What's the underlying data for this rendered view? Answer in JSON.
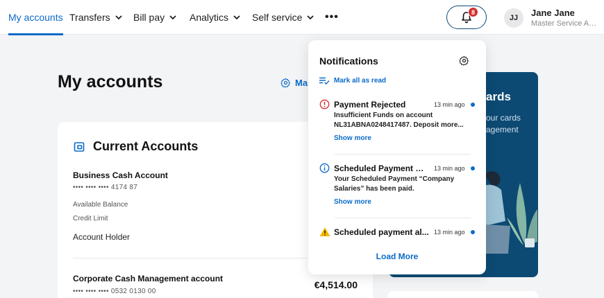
{
  "nav": {
    "items": [
      {
        "label": "My accounts"
      },
      {
        "label": "Transfers"
      },
      {
        "label": "Bill pay"
      },
      {
        "label": "Analytics"
      },
      {
        "label": "Self service"
      }
    ],
    "more": "•••",
    "notification_count": "8"
  },
  "user": {
    "initials": "JJ",
    "name": "Jane Jane",
    "role": "Master Service Agr..."
  },
  "page": {
    "title": "My accounts",
    "manage_label": "Ma"
  },
  "accounts": {
    "title": "Current Accounts",
    "list": [
      {
        "name": "Business Cash Account",
        "number": "•••• •••• •••• 4174 87",
        "available_label": "Available Balance",
        "credit_label": "Credit Limit",
        "holder_label": "Account Holder"
      },
      {
        "name": "Corporate Cash Management account",
        "number": "•••• •••• •••• 0532 0130 00",
        "balance": "€4,514.00"
      }
    ]
  },
  "promo": {
    "title": "ards",
    "line1": "our cards",
    "line2": "agement"
  },
  "notifications": {
    "title": "Notifications",
    "mark_all": "Mark all as read",
    "items": [
      {
        "icon": "error-icon",
        "title": "Payment Rejected",
        "time": "13 min ago",
        "body": "Insufficient Funds on account NL31ABNA0248417487. Deposit more...",
        "show_more": "Show more"
      },
      {
        "icon": "info-icon",
        "title": "Scheduled Payment Co...",
        "time": "13 min ago",
        "body": "Your Scheduled Payment “Company Salaries” has been paid.",
        "show_more": "Show more"
      },
      {
        "icon": "warning-icon",
        "title": "Scheduled payment al...",
        "time": "13 min ago"
      }
    ],
    "load_more": "Load More"
  },
  "colors": {
    "accent": "#0b6bc9",
    "promo_bg": "#0c4a73",
    "error": "#d32f2f",
    "warning": "#f5b800"
  }
}
